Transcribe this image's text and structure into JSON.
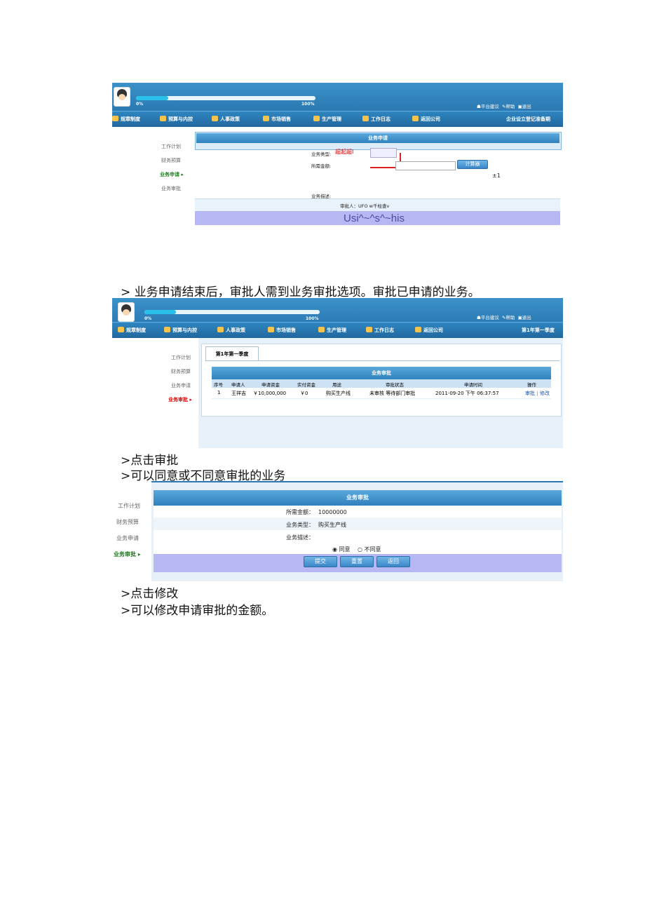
{
  "doc": {
    "line1": "> 业务申请结束后，审批人需到业务审批选项。审批已申请的业务。",
    "line2": ">点击审批",
    "line3": ">可以同意或不同意审批的业务",
    "line4": ">点击修改",
    "line5": ">可以修改申请审批的金额。"
  },
  "common": {
    "progress_start": "0%",
    "progress_end": "100%",
    "progress_fraction": 0.18,
    "top_links": [
      "平台建议",
      "帮助",
      "退出"
    ],
    "nav": [
      "规章制度",
      "预算与内控",
      "人事政策",
      "市场销售",
      "生产管理",
      "工作日志",
      "返回公司"
    ],
    "sidebar": [
      "工作计划",
      "财务预算",
      "业务申请",
      "业务审批"
    ]
  },
  "shot1": {
    "status": "企业设立登记准备期",
    "sidebar_active_marker": "业务申请 ▸",
    "panel_title": "业务申请",
    "type_label": "业务类型:",
    "type_value": "超起超I",
    "amount_label": "所需金额:",
    "calc_button": "计算器",
    "note": "±1",
    "desc_label": "业务描述:",
    "approver_line": "审批人：UFO w千柱查v",
    "footer_text": "Usi^~^s^~his"
  },
  "shot2": {
    "status": "第1年第一季度",
    "tab": "第1年第一季度",
    "panel_title": "业务审批",
    "columns": [
      "序号",
      "申请人",
      "申请资金",
      "实付资金",
      "用途",
      "审批状态",
      "申请时间",
      "操作"
    ],
    "row": [
      "1",
      "王祥吉",
      "￥10,000,000",
      "￥0",
      "购买生产线",
      "未审核 等待部门审批",
      "2011-09-20 下午 06:37:57"
    ],
    "action_approve": "审批",
    "action_sep": "|",
    "action_edit": "修改"
  },
  "shot3": {
    "panel_title": "业务审批",
    "amount_label": "所需金额：",
    "amount_value": "10000000",
    "type_label": "业务类型：",
    "type_value": "购买生产线",
    "desc_label": "业务描述：",
    "agree": "同意",
    "disagree": "不同意",
    "btn_submit": "提交",
    "btn_reset": "重置",
    "btn_back": "返回"
  },
  "colors": {
    "brand_blue": "#2b78b2",
    "header_blue": "#3f8fcb",
    "lavender": "#b7b8f3",
    "row_light": "#eef6fc",
    "active_red": "#d90000"
  }
}
